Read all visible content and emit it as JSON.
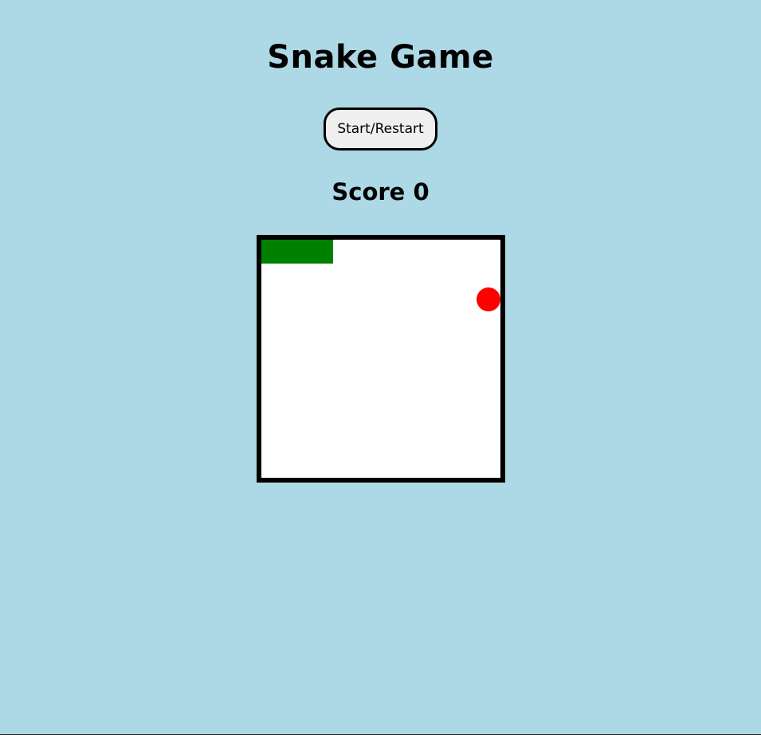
{
  "header": {
    "title": "Snake Game"
  },
  "controls": {
    "start_restart_label": "Start/Restart"
  },
  "score": {
    "label": "Score",
    "value": 0,
    "text": "Score 0"
  },
  "game": {
    "board_color": "#ffffff",
    "board_border_color": "#000000",
    "snake_color": "#008000",
    "food_color": "#ff0000",
    "page_background": "#add8e6"
  }
}
